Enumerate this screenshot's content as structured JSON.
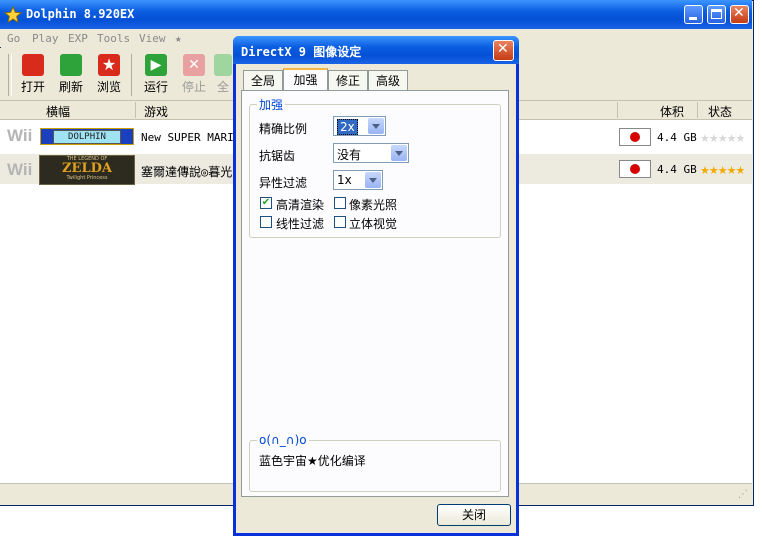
{
  "main": {
    "title": "Dolphin 8.920EX",
    "menu": [
      "Go",
      "Play",
      "EXP",
      "Tools",
      "View",
      "★"
    ],
    "toolbar": [
      {
        "label": "打开",
        "icon": "home-icon",
        "color": "#d92b1b"
      },
      {
        "label": "刷新",
        "icon": "refresh-icon",
        "color": "#2ea33a"
      },
      {
        "label": "浏览",
        "icon": "star-icon",
        "color": "#d92b1b"
      },
      {
        "label": "运行",
        "icon": "play-icon",
        "color": "#2ea33a"
      },
      {
        "label": "停止",
        "icon": "stop-icon",
        "color": "#e08a8a"
      },
      {
        "label": "全",
        "icon": "fullscreen-icon",
        "color": "#8fcf8f"
      }
    ],
    "columns": {
      "banner": "横幅",
      "game": "游戏",
      "size": "体积",
      "state": "状态"
    },
    "games": [
      {
        "platform": "Wii",
        "banner": "DOLPHIN",
        "name": "New SUPER MARIO",
        "size": "4.4 GB",
        "stars": "★★★★★",
        "rating": 0
      },
      {
        "platform": "Wii",
        "banner": "ZELDA",
        "banner_sub": "THE LEGEND OF",
        "banner_sub2": "Twilight Princess",
        "name": "塞爾達傳說◎暮光",
        "size": "4.4 GB",
        "stars": "★★★★★",
        "rating": 5
      }
    ]
  },
  "dialog": {
    "title": "DirectX 9 图像设定",
    "tabs": [
      "全局",
      "加强",
      "修正",
      "高级"
    ],
    "active_tab": "加强",
    "group_title": "加强",
    "settings": [
      {
        "label": "精确比例",
        "value": "2x"
      },
      {
        "label": "抗锯齿",
        "value": "没有"
      },
      {
        "label": "异性过滤",
        "value": "1x"
      }
    ],
    "checkboxes": [
      {
        "label": "高清渲染",
        "checked": true
      },
      {
        "label": "像素光照",
        "checked": false
      },
      {
        "label": "线性过滤",
        "checked": false
      },
      {
        "label": "立体视觉",
        "checked": false
      }
    ],
    "info_title": "o(∩_∩)o",
    "info_text": "蓝色宇宙★优化编译",
    "close_label": "关闭"
  }
}
